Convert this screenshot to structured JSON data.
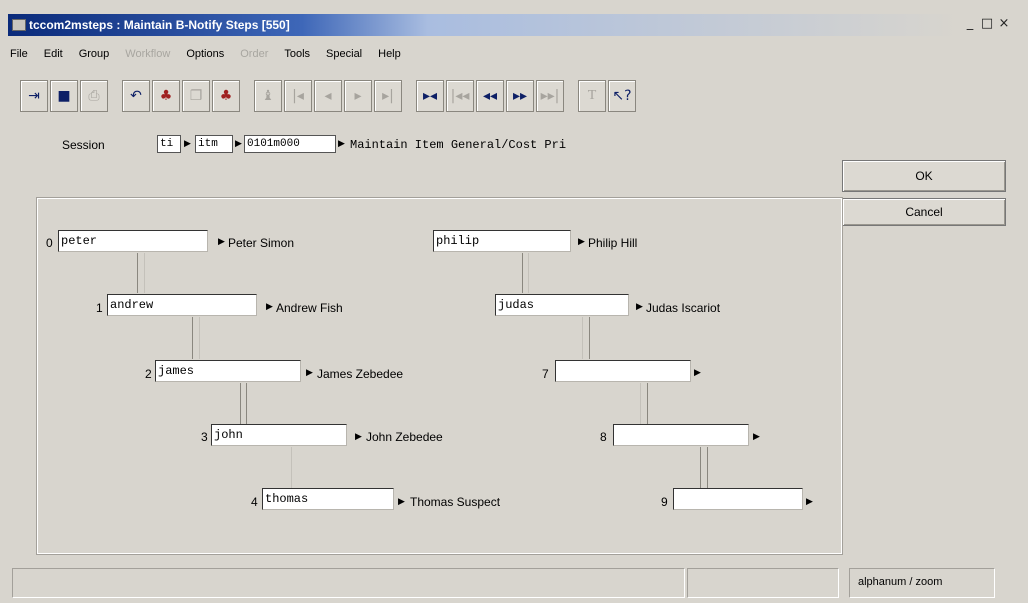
{
  "window": {
    "title": "tccom2msteps : Maintain B-Notify Steps [550]",
    "controls": [
      "_",
      "□",
      "×"
    ]
  },
  "menu": [
    {
      "label": "File",
      "enabled": true
    },
    {
      "label": "Edit",
      "enabled": true
    },
    {
      "label": "Group",
      "enabled": true
    },
    {
      "label": "Workflow",
      "enabled": false
    },
    {
      "label": "Options",
      "enabled": true
    },
    {
      "label": "Order",
      "enabled": false
    },
    {
      "label": "Tools",
      "enabled": true
    },
    {
      "label": "Special",
      "enabled": true
    },
    {
      "label": "Help",
      "enabled": true
    }
  ],
  "toolbar": {
    "icons": [
      "exit-icon",
      "save-icon",
      "print-icon",
      "undo-icon",
      "new-group-icon",
      "copy-icon",
      "delete-group-icon",
      "find-icon",
      "first-record-icon",
      "previous-record-icon",
      "next-record-icon",
      "last-record-icon",
      "first-group-icon",
      "first-set-icon",
      "previous-set-icon",
      "next-set-icon",
      "last-set-icon",
      "text-icon",
      "help-icon"
    ]
  },
  "session": {
    "label": "Session",
    "package": "ti",
    "module": "itm",
    "code": "0101m000",
    "description": "Maintain Item General/Cost Pri"
  },
  "buttons": {
    "ok": "OK",
    "cancel": "Cancel"
  },
  "steps_left": [
    {
      "num": "0",
      "value": "peter",
      "name": "Peter Simon"
    },
    {
      "num": "1",
      "value": "andrew",
      "name": "Andrew Fish"
    },
    {
      "num": "2",
      "value": "james",
      "name": "James Zebedee"
    },
    {
      "num": "3",
      "value": "john",
      "name": "John Zebedee"
    },
    {
      "num": "4",
      "value": "thomas",
      "name": "Thomas Suspect"
    }
  ],
  "steps_right": [
    {
      "num": "",
      "value": "philip",
      "name": "Philip Hill"
    },
    {
      "num": "",
      "value": "judas",
      "name": "Judas Iscariot"
    },
    {
      "num": "7",
      "value": "",
      "name": ""
    },
    {
      "num": "8",
      "value": "",
      "name": ""
    },
    {
      "num": "9",
      "value": "",
      "name": ""
    }
  ],
  "status": {
    "cell1": "",
    "cell2": "",
    "mode": "alphanum / zoom"
  }
}
